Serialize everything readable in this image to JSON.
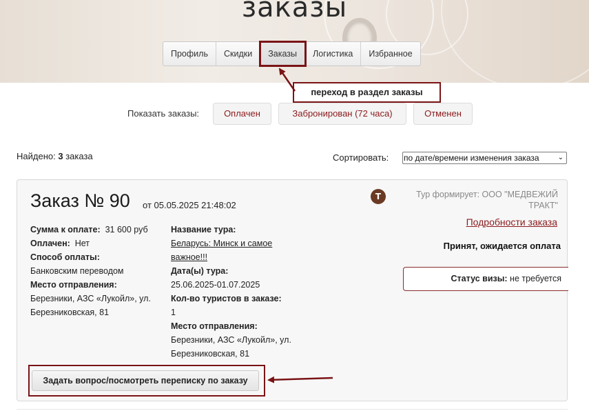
{
  "header": {
    "title": "заказы",
    "tabs": [
      {
        "label": "Профиль"
      },
      {
        "label": "Скидки"
      },
      {
        "label": "Заказы",
        "active": true
      },
      {
        "label": "Логистика"
      },
      {
        "label": "Избранное"
      }
    ]
  },
  "annotations": {
    "tab_callout": "переход в раздел заказы"
  },
  "filter": {
    "label": "Показать заказы:",
    "buttons": [
      "Оплачен",
      "Забронирован (72 часа)",
      "Отменен"
    ]
  },
  "results": {
    "found_prefix": "Найдено:",
    "found_count": "3",
    "found_suffix": "заказа",
    "sort_label": "Сортировать:",
    "sort_value": "по дате/времени изменения заказа"
  },
  "order": {
    "title": "Заказ № 90",
    "date": "от 05.05.2025 21:48:02",
    "avatar_letter": "Т",
    "operator": "Тур формирует: ООО \"МЕДВЕЖИЙ ТРАКТ\"",
    "details_link": "Подробности заказа",
    "status": "Принят, ожидается оплата",
    "visa_label": "Статус визы:",
    "visa_value": "не требуется",
    "left": {
      "amount_label": "Сумма к оплате:",
      "amount_value": "31 600 руб",
      "paid_label": "Оплачен:",
      "paid_value": "Нет",
      "payment_label": "Способ оплаты:",
      "payment_value": "Банковским переводом",
      "departure_label": "Место отправления:",
      "departure_line1": "Березники, АЗС «Лукойл», ул.",
      "departure_line2": "Березниковская, 81"
    },
    "middle": {
      "tour_label": "Название тура:",
      "tour_line1": "Беларусь: Минск и самое",
      "tour_line2": "важное!!!",
      "dates_label": "Дата(ы) тура:",
      "dates_value": "25.06.2025-01.07.2025",
      "tourists_label": "Кол-во туристов в заказе:",
      "tourists_value": "1",
      "departure_label": "Место отправления:",
      "departure_line1": "Березники, АЗС «Лукойл», ул.",
      "departure_line2": "Березниковская, 81"
    },
    "ask_button": "Задать вопрос/посмотреть переписку по заказу"
  },
  "colors": {
    "accent": "#7a1316",
    "link": "#8a1a1c"
  }
}
